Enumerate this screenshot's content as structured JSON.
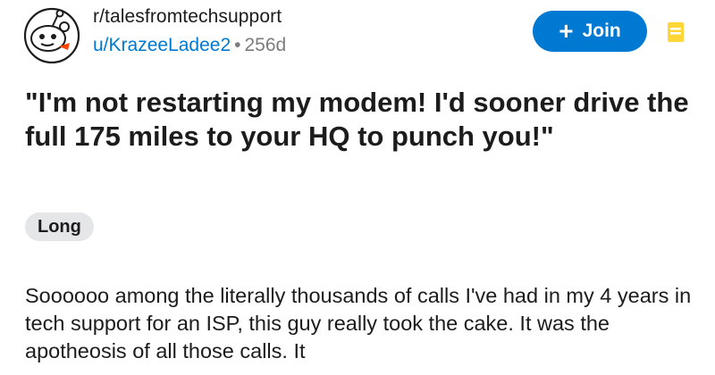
{
  "post": {
    "subreddit": "r/talesfromtechsupport",
    "author": "u/KrazeeLadee2",
    "separator": "•",
    "age": "256d",
    "title": "\"I'm not restarting my modem! I'd sooner drive the full 175 miles to your HQ to punch you!\"",
    "flair": "Long",
    "body": "Soooooo among the literally thousands of calls I've had in my 4 years in tech support for an ISP, this guy really took the cake. It was the apotheosis of all those calls. It"
  },
  "join_button": {
    "plus": "+",
    "label": "Join"
  },
  "colors": {
    "accent": "#0079d3",
    "mod_icon": "#ffd635"
  },
  "icons": {
    "avatar": "snoo-avatar-icon",
    "mod": "mod-shield-icon"
  }
}
